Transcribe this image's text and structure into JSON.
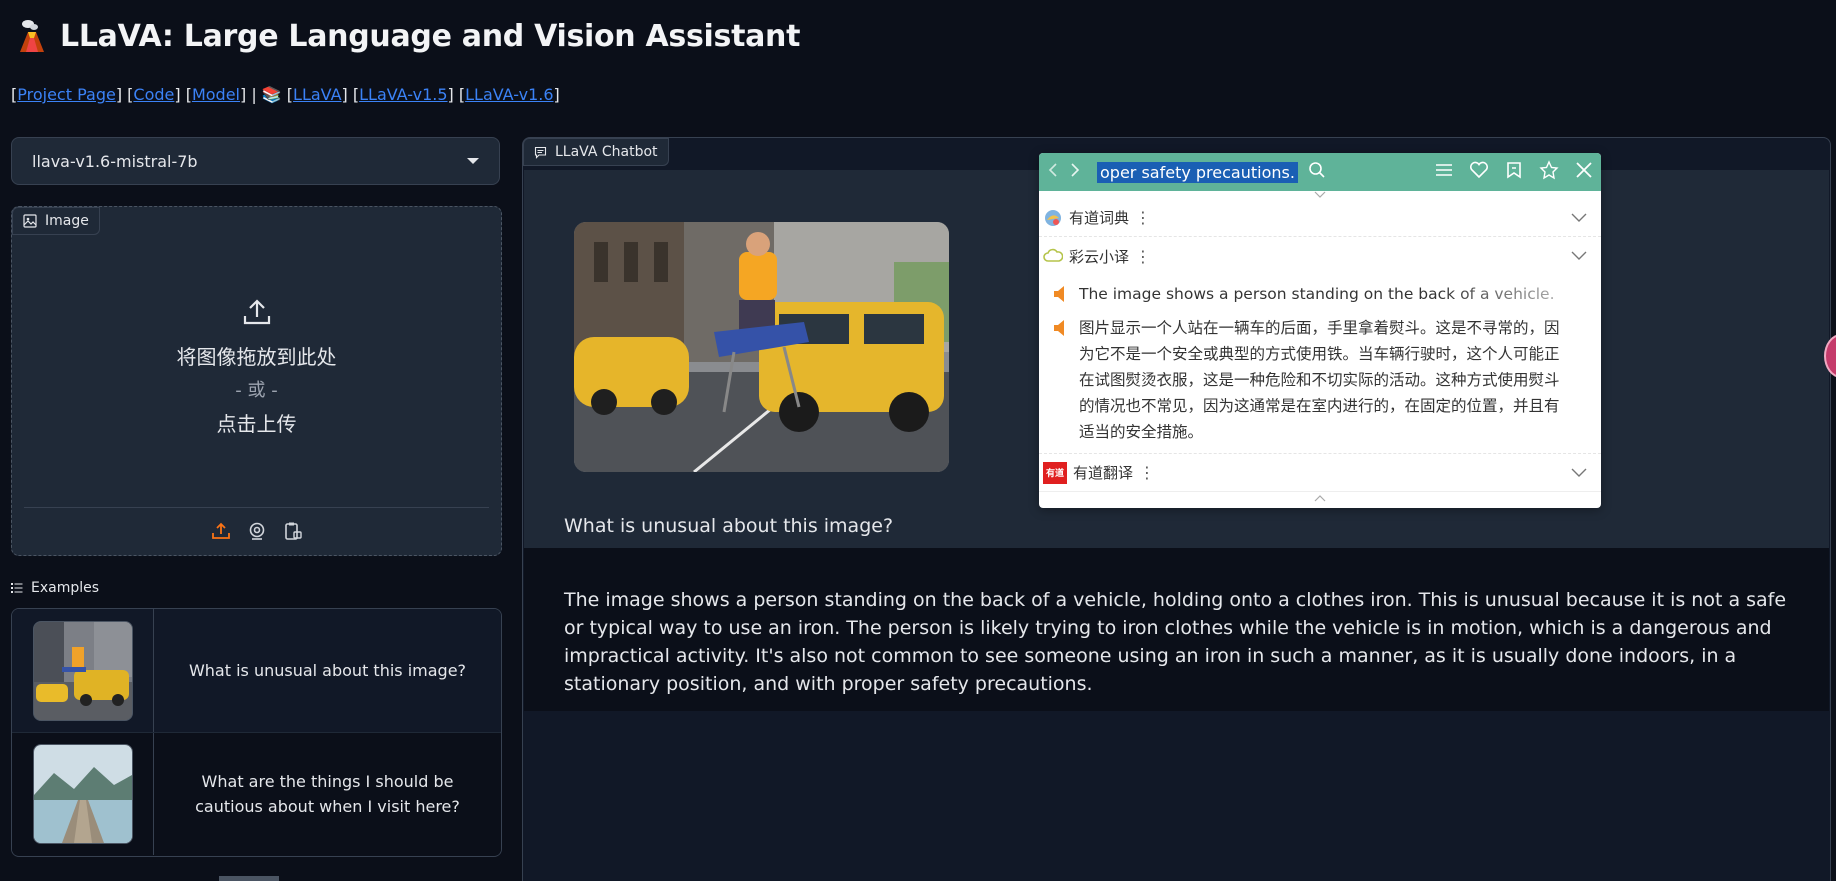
{
  "header": {
    "title": "LLaVA: Large Language and Vision Assistant"
  },
  "links": {
    "project_page": "Project Page",
    "code": "Code",
    "model": "Model",
    "llava": "LLaVA",
    "llava_v15": "LLaVA-v1.5",
    "llava_v16": "LLaVA-v1.6"
  },
  "model_select": {
    "value": "llava-v1.6-mistral-7b"
  },
  "image_panel": {
    "label": "Image",
    "drop_text": "将图像拖放到此处",
    "or_text": "- 或 -",
    "click_text": "点击上传"
  },
  "examples": {
    "label": "Examples",
    "items": [
      {
        "text": "What is unusual about this image?"
      },
      {
        "text": "What are the things I should be cautious about when I visit here?"
      }
    ]
  },
  "chatbot": {
    "label": "LLaVA Chatbot",
    "user_message": "What is unusual about this image?",
    "bot_message": "The image shows a person standing on the back of a vehicle, holding onto a clothes iron. This is unusual because it is not a safe or typical way to use an iron. The person is likely trying to iron clothes while the vehicle is in motion, which is a dangerous and impractical activity. It's also not common to see someone using an iron in such a manner, as it is usually done indoors, in a stationary position, and with proper safety precautions."
  },
  "popup": {
    "selected_text": "oper safety precautions.",
    "dict1": "有道词典",
    "dict2": "彩云小译",
    "dict3": "有道翻译",
    "dict3_logo": "有道",
    "translation_en": "The image shows a person standing on the back of a vehicle.",
    "translation_zh": "图片显示一个人站在一辆车的后面，手里拿着熨斗。这是不寻常的，因为它不是一个安全或典型的方式使用铁。当车辆行驶时，这个人可能正在试图熨烫衣服，这是一种危险和不切实际的活动。这种方式使用熨斗的情况也不常见，因为这通常是在室内进行的，在固定的位置，并且有适当的安全措施。"
  },
  "colors": {
    "background": "#0b0f19",
    "panel": "#1f2937",
    "link": "#3b82f6",
    "popup_bar": "#5fb399",
    "accent": "#f97316"
  }
}
